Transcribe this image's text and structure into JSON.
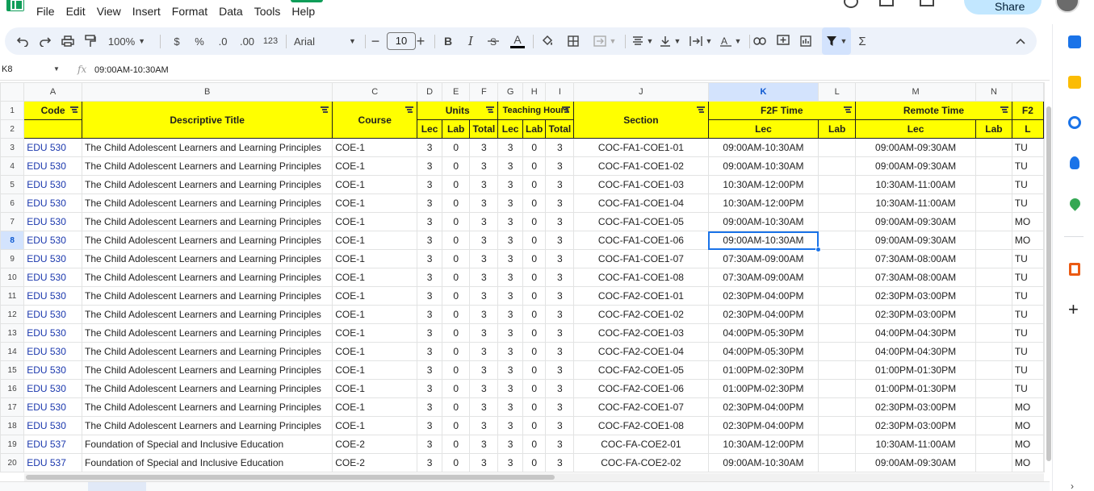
{
  "menu": [
    "File",
    "Edit",
    "View",
    "Insert",
    "Format",
    "Data",
    "Tools",
    "Help"
  ],
  "share_label": "Share",
  "toolbar": {
    "zoom": "100%",
    "currency": "$",
    "percent": "%",
    "dec_dec": ".0",
    "inc_dec": ".00",
    "num_format": "123",
    "font": "Arial",
    "font_size": "10",
    "bold": "B",
    "italic": "I",
    "text_color": "A",
    "sigma": "Σ"
  },
  "formula_bar": {
    "cell_ref": "K8",
    "fx": "fx",
    "value": "09:00AM-10:30AM"
  },
  "columns": [
    "A",
    "B",
    "C",
    "D",
    "E",
    "F",
    "G",
    "H",
    "I",
    "J",
    "K",
    "L",
    "M",
    "N",
    ""
  ],
  "header_row1": {
    "code": "Code",
    "title": "Descriptive Title",
    "course": "Course",
    "units": "Units",
    "teaching": "Teaching Hours",
    "section": "Section",
    "f2f": "F2F Time",
    "remote": "Remote Time",
    "o": "F2"
  },
  "header_row2": {
    "units_lec": "Lec",
    "units_lab": "Lab",
    "units_total": "Total",
    "th_lec": "Lec",
    "th_lab": "Lab",
    "th_total": "Total",
    "f2f_lec": "Lec",
    "f2f_lab": "Lab",
    "rem_lec": "Lec",
    "rem_lab": "Lab",
    "o": "L"
  },
  "rows": [
    {
      "n": "3",
      "code": "EDU 530",
      "title": "The Child Adolescent Learners and Learning Principles",
      "course": "COE-1",
      "d": "3",
      "e": "0",
      "f": "3",
      "g": "3",
      "h": "0",
      "i": "3",
      "section": "COC-FA1-COE1-01",
      "f2f": "09:00AM-10:30AM",
      "remote": "09:00AM-09:30AM",
      "o": "TU"
    },
    {
      "n": "4",
      "code": "EDU 530",
      "title": "The Child Adolescent Learners and Learning Principles",
      "course": "COE-1",
      "d": "3",
      "e": "0",
      "f": "3",
      "g": "3",
      "h": "0",
      "i": "3",
      "section": "COC-FA1-COE1-02",
      "f2f": "09:00AM-10:30AM",
      "remote": "09:00AM-09:30AM",
      "o": "TU"
    },
    {
      "n": "5",
      "code": "EDU 530",
      "title": "The Child Adolescent Learners and Learning Principles",
      "course": "COE-1",
      "d": "3",
      "e": "0",
      "f": "3",
      "g": "3",
      "h": "0",
      "i": "3",
      "section": "COC-FA1-COE1-03",
      "f2f": "10:30AM-12:00PM",
      "remote": "10:30AM-11:00AM",
      "o": "TU"
    },
    {
      "n": "6",
      "code": "EDU 530",
      "title": "The Child Adolescent Learners and Learning Principles",
      "course": "COE-1",
      "d": "3",
      "e": "0",
      "f": "3",
      "g": "3",
      "h": "0",
      "i": "3",
      "section": "COC-FA1-COE1-04",
      "f2f": "10:30AM-12:00PM",
      "remote": "10:30AM-11:00AM",
      "o": "TU"
    },
    {
      "n": "7",
      "code": "EDU 530",
      "title": "The Child Adolescent Learners and Learning Principles",
      "course": "COE-1",
      "d": "3",
      "e": "0",
      "f": "3",
      "g": "3",
      "h": "0",
      "i": "3",
      "section": "COC-FA1-COE1-05",
      "f2f": "09:00AM-10:30AM",
      "remote": "09:00AM-09:30AM",
      "o": "MO"
    },
    {
      "n": "8",
      "code": "EDU 530",
      "title": "The Child Adolescent Learners and Learning Principles",
      "course": "COE-1",
      "d": "3",
      "e": "0",
      "f": "3",
      "g": "3",
      "h": "0",
      "i": "3",
      "section": "COC-FA1-COE1-06",
      "f2f": "09:00AM-10:30AM",
      "remote": "09:00AM-09:30AM",
      "o": "MO"
    },
    {
      "n": "9",
      "code": "EDU 530",
      "title": "The Child Adolescent Learners and Learning Principles",
      "course": "COE-1",
      "d": "3",
      "e": "0",
      "f": "3",
      "g": "3",
      "h": "0",
      "i": "3",
      "section": "COC-FA1-COE1-07",
      "f2f": "07:30AM-09:00AM",
      "remote": "07:30AM-08:00AM",
      "o": "TU"
    },
    {
      "n": "10",
      "code": "EDU 530",
      "title": "The Child Adolescent Learners and Learning Principles",
      "course": "COE-1",
      "d": "3",
      "e": "0",
      "f": "3",
      "g": "3",
      "h": "0",
      "i": "3",
      "section": "COC-FA1-COE1-08",
      "f2f": "07:30AM-09:00AM",
      "remote": "07:30AM-08:00AM",
      "o": "TU"
    },
    {
      "n": "11",
      "code": "EDU 530",
      "title": "The Child Adolescent Learners and Learning Principles",
      "course": "COE-1",
      "d": "3",
      "e": "0",
      "f": "3",
      "g": "3",
      "h": "0",
      "i": "3",
      "section": "COC-FA2-COE1-01",
      "f2f": "02:30PM-04:00PM",
      "remote": "02:30PM-03:00PM",
      "o": "TU"
    },
    {
      "n": "12",
      "code": "EDU 530",
      "title": "The Child Adolescent Learners and Learning Principles",
      "course": "COE-1",
      "d": "3",
      "e": "0",
      "f": "3",
      "g": "3",
      "h": "0",
      "i": "3",
      "section": "COC-FA2-COE1-02",
      "f2f": "02:30PM-04:00PM",
      "remote": "02:30PM-03:00PM",
      "o": "TU"
    },
    {
      "n": "13",
      "code": "EDU 530",
      "title": "The Child Adolescent Learners and Learning Principles",
      "course": "COE-1",
      "d": "3",
      "e": "0",
      "f": "3",
      "g": "3",
      "h": "0",
      "i": "3",
      "section": "COC-FA2-COE1-03",
      "f2f": "04:00PM-05:30PM",
      "remote": "04:00PM-04:30PM",
      "o": "TU"
    },
    {
      "n": "14",
      "code": "EDU 530",
      "title": "The Child Adolescent Learners and Learning Principles",
      "course": "COE-1",
      "d": "3",
      "e": "0",
      "f": "3",
      "g": "3",
      "h": "0",
      "i": "3",
      "section": "COC-FA2-COE1-04",
      "f2f": "04:00PM-05:30PM",
      "remote": "04:00PM-04:30PM",
      "o": "TU"
    },
    {
      "n": "15",
      "code": "EDU 530",
      "title": "The Child Adolescent Learners and Learning Principles",
      "course": "COE-1",
      "d": "3",
      "e": "0",
      "f": "3",
      "g": "3",
      "h": "0",
      "i": "3",
      "section": "COC-FA2-COE1-05",
      "f2f": "01:00PM-02:30PM",
      "remote": "01:00PM-01:30PM",
      "o": "TU"
    },
    {
      "n": "16",
      "code": "EDU 530",
      "title": "The Child Adolescent Learners and Learning Principles",
      "course": "COE-1",
      "d": "3",
      "e": "0",
      "f": "3",
      "g": "3",
      "h": "0",
      "i": "3",
      "section": "COC-FA2-COE1-06",
      "f2f": "01:00PM-02:30PM",
      "remote": "01:00PM-01:30PM",
      "o": "TU"
    },
    {
      "n": "17",
      "code": "EDU 530",
      "title": "The Child Adolescent Learners and Learning Principles",
      "course": "COE-1",
      "d": "3",
      "e": "0",
      "f": "3",
      "g": "3",
      "h": "0",
      "i": "3",
      "section": "COC-FA2-COE1-07",
      "f2f": "02:30PM-04:00PM",
      "remote": "02:30PM-03:00PM",
      "o": "MO"
    },
    {
      "n": "18",
      "code": "EDU 530",
      "title": "The Child Adolescent Learners and Learning Principles",
      "course": "COE-1",
      "d": "3",
      "e": "0",
      "f": "3",
      "g": "3",
      "h": "0",
      "i": "3",
      "section": "COC-FA2-COE1-08",
      "f2f": "02:30PM-04:00PM",
      "remote": "02:30PM-03:00PM",
      "o": "MO"
    },
    {
      "n": "19",
      "code": "EDU 537",
      "title": "Foundation of Special and Inclusive Education",
      "course": "COE-2",
      "d": "3",
      "e": "0",
      "f": "3",
      "g": "3",
      "h": "0",
      "i": "3",
      "section": "COC-FA-COE2-01",
      "f2f": "10:30AM-12:00PM",
      "remote": "10:30AM-11:00AM",
      "o": "MO"
    },
    {
      "n": "20",
      "code": "EDU 537",
      "title": "Foundation of Special and Inclusive Education",
      "course": "COE-2",
      "d": "3",
      "e": "0",
      "f": "3",
      "g": "3",
      "h": "0",
      "i": "3",
      "section": "COC-FA-COE2-02",
      "f2f": "09:00AM-10:30AM",
      "remote": "09:00AM-09:30AM",
      "o": "MO"
    }
  ],
  "active_cell": "K8",
  "colors": {
    "header_fill": "#ffff00",
    "code_text": "#1a37ad",
    "selection": "#1a73e8"
  },
  "icons": [
    "undo-icon",
    "redo-icon",
    "print-icon",
    "paint-format-icon",
    "fill-color-icon",
    "borders-icon",
    "merge-icon",
    "align-icon",
    "valign-icon",
    "wrap-icon",
    "rotate-icon",
    "link-icon",
    "comment-icon",
    "chart-icon",
    "filter-icon",
    "functions-icon",
    "collapse-icon"
  ]
}
